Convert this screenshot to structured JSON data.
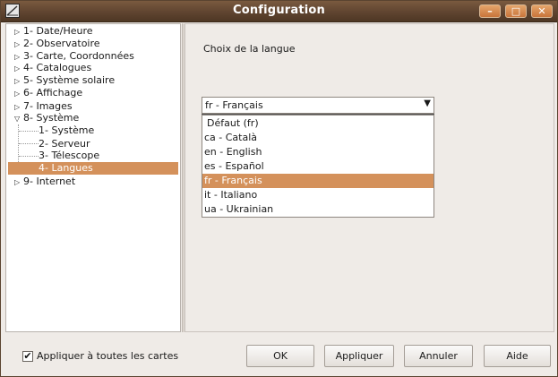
{
  "window": {
    "title": "Configuration",
    "minimize_glyph": "–",
    "maximize_glyph": "□",
    "close_glyph": "✕",
    "accent_color": "#d4915b"
  },
  "tree": {
    "items": [
      {
        "label": "1- Date/Heure",
        "expanded": false
      },
      {
        "label": "2- Observatoire",
        "expanded": false
      },
      {
        "label": "3- Carte, Coordonnées",
        "expanded": false
      },
      {
        "label": "4- Catalogues",
        "expanded": false
      },
      {
        "label": "5- Système solaire",
        "expanded": false
      },
      {
        "label": "6- Affichage",
        "expanded": false
      },
      {
        "label": "7- Images",
        "expanded": false
      },
      {
        "label": "8- Système",
        "expanded": true
      },
      {
        "label": "9- Internet",
        "expanded": false
      }
    ],
    "children": [
      {
        "label": "1- Système"
      },
      {
        "label": "2- Serveur"
      },
      {
        "label": "3- Télescope"
      },
      {
        "label": "4- Langues",
        "selected": true
      }
    ],
    "arrow_collapsed": "▷",
    "arrow_expanded": "▽"
  },
  "language": {
    "label": "Choix de la langue",
    "selected_value": "fr - Français",
    "options": [
      "Défaut (fr)",
      "ca - Català",
      "en - English",
      "es - Español",
      "fr - Français",
      "it - Italiano",
      "ua - Ukrainian"
    ],
    "selected_index": 4
  },
  "footer": {
    "apply_all_label": "Appliquer à toutes les cartes",
    "apply_all_checked": true,
    "check_glyph": "✔",
    "ok_label": "OK",
    "apply_label": "Appliquer",
    "cancel_label": "Annuler",
    "help_label": "Aide"
  }
}
